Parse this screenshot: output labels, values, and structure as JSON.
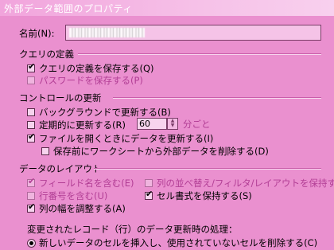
{
  "window": {
    "title": "外部データ範囲のプロパティ"
  },
  "name": {
    "label": "名前(N):"
  },
  "query_section": {
    "title": "クエリの定義",
    "save_query": {
      "label": "クエリの定義を保存する(Q)",
      "checked": true
    },
    "save_password": {
      "label": "パスワードを保存する(P)",
      "checked": false
    }
  },
  "refresh_section": {
    "title": "コントロールの更新",
    "background": {
      "label": "バックグラウンドで更新する(B)",
      "checked": false
    },
    "periodic": {
      "label": "定期的に更新する(R)",
      "checked": false,
      "value": "60",
      "unit": "分ごと"
    },
    "on_open": {
      "label": "ファイルを開くときにデータを更新する(I)",
      "checked": true
    },
    "remove_before_save": {
      "label": "保存前にワークシートから外部データを削除する(D)",
      "checked": false
    }
  },
  "layout_section": {
    "title": "データのレイアウト",
    "field_names": {
      "label": "フィールド名を含む(E)",
      "checked": true
    },
    "row_numbers": {
      "label": "行番号を含む(U)",
      "checked": false
    },
    "adjust_width": {
      "label": "列の幅を調整する(A)",
      "checked": true
    },
    "preserve_sort": {
      "label": "列の並べ替え/フィルタ/レイアウトを保持する",
      "checked": false
    },
    "preserve_format": {
      "label": "セル書式を保持する(S)",
      "checked": true
    }
  },
  "refresh_action": {
    "title": "変更されたレコード（行）のデータ更新時の処理：",
    "insert_cells": {
      "label": "新しいデータのセルを挿入し、使用されていないセルを削除する(C)",
      "selected": true
    }
  }
}
